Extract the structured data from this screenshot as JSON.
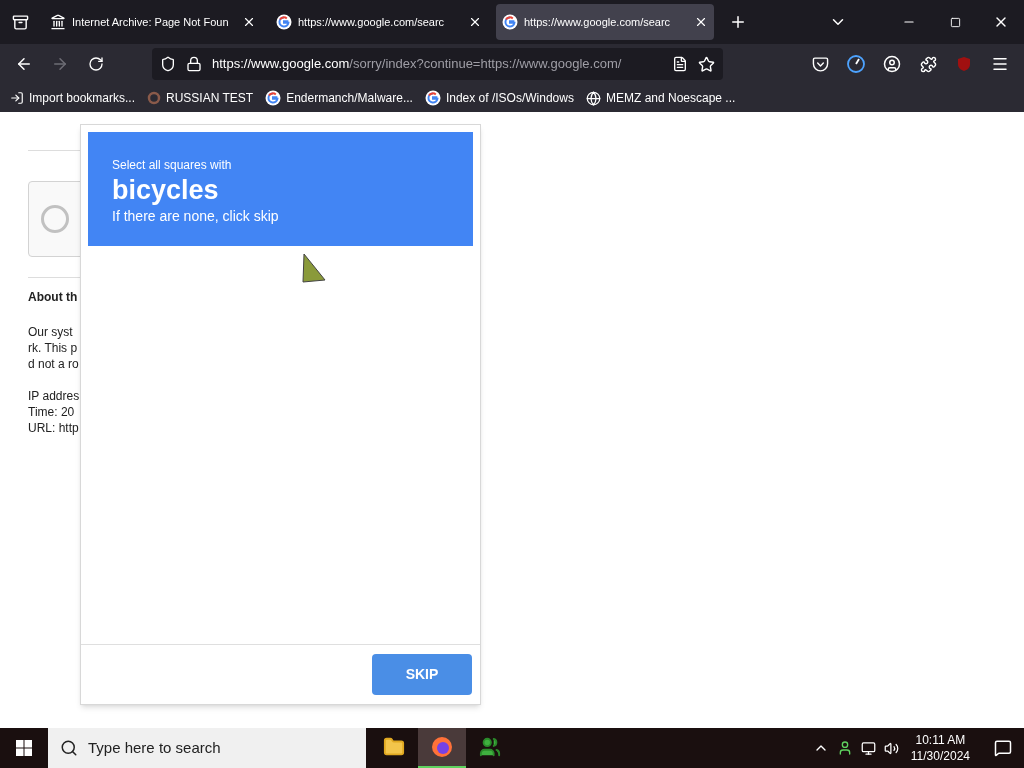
{
  "tabs": [
    {
      "title": "Internet Archive: Page Not Foun",
      "kind": "archive",
      "selected": false
    },
    {
      "title": "https://www.google.com/searc",
      "kind": "google",
      "selected": false
    },
    {
      "title": "https://www.google.com/searc",
      "kind": "google",
      "selected": true
    }
  ],
  "address_bar": {
    "host": "https://www.google.com",
    "path": "/sorry/index?continue=https://www.google.com/"
  },
  "bookmarks": [
    {
      "label": "Import bookmarks...",
      "kind": "import"
    },
    {
      "label": "RUSSIAN TEST",
      "kind": "ring"
    },
    {
      "label": "Endermanch/Malware...",
      "kind": "google"
    },
    {
      "label": "Index of /ISOs/Windows",
      "kind": "google"
    },
    {
      "label": "MEMZ and Noescape ...",
      "kind": "globe"
    }
  ],
  "page": {
    "robot_checkbox": {
      "checked": false
    },
    "about_heading": "About th",
    "about_lines": [
      "Our syst",
      "rk. This p",
      "d not a ro"
    ],
    "details": [
      "IP addres",
      "Time: 20",
      "URL: http"
    ]
  },
  "challenge": {
    "instruction": "Select all squares with",
    "target": "bicycles",
    "hint": "If there are none, click skip",
    "button": "SKIP"
  },
  "taskbar": {
    "search_placeholder": "Type here to search",
    "apps": [
      {
        "kind": "folder",
        "selected": false
      },
      {
        "kind": "firefox",
        "selected": true
      },
      {
        "kind": "people",
        "selected": false
      }
    ],
    "time": "10:11 AM",
    "date": "11/30/2024"
  }
}
